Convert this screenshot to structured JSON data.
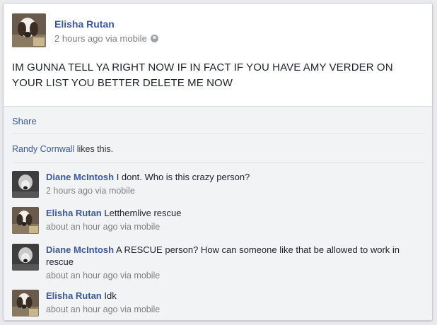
{
  "post": {
    "author": "Elisha Rutan",
    "timestamp": "2 hours ago via mobile",
    "privacy_icon": "globe-icon",
    "text": "IM GUNNA TELL YA RIGHT NOW IF IN FACT IF YOU HAVE AMY VERDER ON YOUR LIST YOU BETTER DELETE ME NOW"
  },
  "actions": {
    "share_label": "Share"
  },
  "likes": {
    "name": "Randy Cornwall",
    "suffix": " likes this."
  },
  "comments": [
    {
      "author": "Diane McIntosh",
      "text": "I dont. Who is this crazy person?",
      "timestamp": "2 hours ago via mobile"
    },
    {
      "author": "Elisha Rutan",
      "text": "Letthemlive rescue",
      "timestamp": "about an hour ago via mobile"
    },
    {
      "author": "Diane McIntosh",
      "text": "A RESCUE person? How can someone like that be allowed to work in rescue",
      "timestamp": "about an hour ago via mobile"
    },
    {
      "author": "Elisha Rutan",
      "text": "Idk",
      "timestamp": "about an hour ago via mobile"
    }
  ],
  "colors": {
    "link": "#3b5998",
    "meta": "#7f7f7f",
    "feedback_bg": "#f2f3f5"
  }
}
